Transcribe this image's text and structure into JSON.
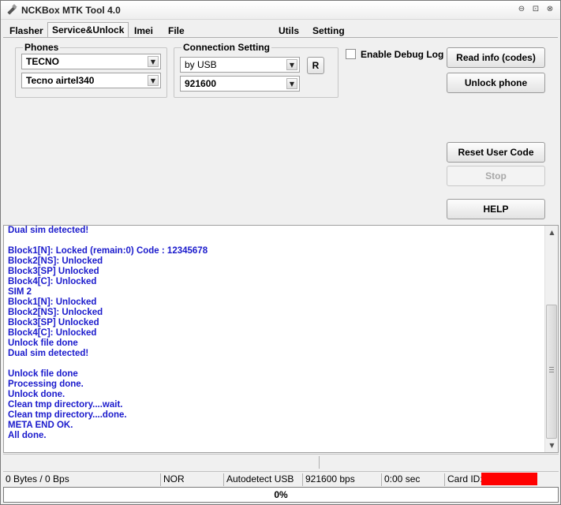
{
  "window": {
    "title": "NCKBox MTK Tool 4.0",
    "min_glyph": "⊖",
    "max_glyph": "⊡",
    "close_glyph": "⊗"
  },
  "tabs": [
    {
      "label": "Flasher",
      "active": false
    },
    {
      "label": "Service&Unlock",
      "active": true
    },
    {
      "label": "Imei",
      "active": false
    },
    {
      "label": "File manager&Backup",
      "active": false
    },
    {
      "label": "Utils",
      "active": false
    },
    {
      "label": "Setting",
      "active": false
    }
  ],
  "phones": {
    "label": "Phones",
    "brand": "TECNO",
    "model": "Tecno airtel340"
  },
  "connection": {
    "label": "Connection Setting",
    "method": "by USB",
    "baud": "921600",
    "r_button": "R"
  },
  "debug": {
    "label": "Enable Debug Log",
    "checked": false
  },
  "buttons": {
    "read_info": "Read info (codes)",
    "unlock_phone": "Unlock phone",
    "reset_user_code": "Reset User Code",
    "stop": "Stop",
    "help": "HELP"
  },
  "log": [
    "Dual sim detected!",
    "",
    "Block1[N]: Locked (remain:0) Code : 12345678",
    "Block2[NS]: Unlocked",
    "Block3[SP] Unlocked",
    "Block4[C]: Unlocked",
    "SIM 2",
    "Block1[N]: Unlocked",
    "Block2[NS]: Unlocked",
    "Block3[SP] Unlocked",
    "Block4[C]: Unlocked",
    "Unlock file done",
    "Dual sim detected!",
    "",
    "Unlock file done",
    "Processing done.",
    "Unlock done.",
    "Clean tmp directory....wait.",
    "Clean tmp directory....done.",
    "META END OK.",
    "All done."
  ],
  "status": {
    "bytes": "0 Bytes / 0 Bps",
    "mode": "NOR",
    "port": "Autodetect USB",
    "baud": "921600 bps",
    "time": "0:00 sec",
    "card_label": "Card ID:"
  },
  "progress": {
    "text": "0%",
    "value": 0
  },
  "colors": {
    "log_text": "#1a1acc",
    "card_id_mask": "#ff0000",
    "progress_fill": "#06b025"
  }
}
